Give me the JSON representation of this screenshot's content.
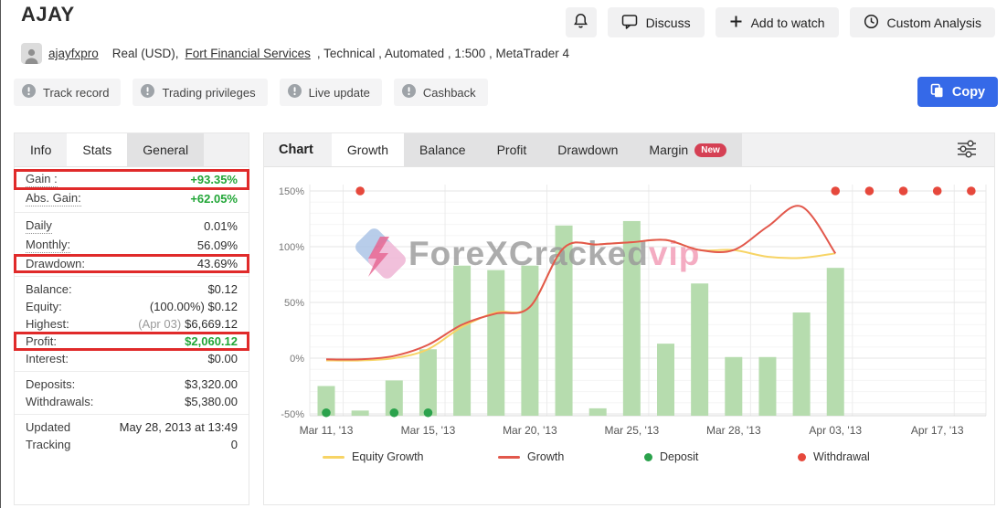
{
  "header": {
    "title": "AJAY",
    "account": {
      "username": "ajayfxpro",
      "descriptor": "Real (USD),",
      "broker": "Fort Financial Services",
      "details": ", Technical , Automated , 1:500 , MetaTrader 4"
    },
    "badges": [
      "Track record",
      "Trading privileges",
      "Live update",
      "Cashback"
    ],
    "actions": {
      "discuss": "Discuss",
      "add_to_watch": "Add to watch",
      "custom_analysis": "Custom Analysis",
      "copy": "Copy"
    }
  },
  "colors": {
    "highlight_box": "#e02a2a",
    "positive_green": "#21a637",
    "copy_button_blue": "#3569e8",
    "new_badge_red": "#d54054"
  },
  "stats_panel": {
    "tabs": [
      {
        "label": "Info",
        "selected": false,
        "variant": "plain"
      },
      {
        "label": "Stats",
        "selected": true
      },
      {
        "label": "General",
        "selected": false,
        "variant": "chip"
      }
    ],
    "rows": [
      {
        "label": "Gain :",
        "value": "+93.35%",
        "value_color": "green",
        "boxed": true,
        "dotted": true
      },
      {
        "label": "Abs. Gain:",
        "value": "+62.05%",
        "value_color": "green",
        "dotted": true
      },
      {
        "divider": true
      },
      {
        "label": "Daily",
        "value": "0.01%",
        "dotted": true
      },
      {
        "label": "Monthly:",
        "value": "56.09%",
        "dotted": true
      },
      {
        "label": "Drawdown:",
        "value": "43.69%",
        "boxed": true
      },
      {
        "divider": true
      },
      {
        "label": "Balance:",
        "value": "$0.12"
      },
      {
        "label": "Equity:",
        "value": "(100.00%) $0.12"
      },
      {
        "label": "Highest:",
        "pre": "(Apr 03)",
        "value": "$6,669.12"
      },
      {
        "label": "Profit:",
        "value": "$2,060.12",
        "value_color": "green",
        "boxed": true
      },
      {
        "label": "Interest:",
        "value": "$0.00"
      },
      {
        "divider": true
      },
      {
        "label": "Deposits:",
        "value": "$3,320.00"
      },
      {
        "label": "Withdrawals:",
        "value": "$5,380.00"
      },
      {
        "divider": true
      },
      {
        "label": "Updated",
        "value": "May 28, 2013 at 13:49"
      },
      {
        "label": "Tracking",
        "value": "0"
      }
    ]
  },
  "chart_panel": {
    "label": "Chart",
    "tabs": [
      {
        "label": "Growth",
        "selected": true
      },
      {
        "label": "Balance",
        "selected": false
      },
      {
        "label": "Profit",
        "selected": false
      },
      {
        "label": "Drawdown",
        "selected": false
      },
      {
        "label": "Margin",
        "selected": false,
        "badge": "New"
      }
    ]
  },
  "chart_data": {
    "type": "bar+line",
    "title": "Growth",
    "slot_count": 20,
    "x_labels": [
      {
        "index": 0,
        "label": "Mar 11, '13"
      },
      {
        "index": 3,
        "label": "Mar 15, '13"
      },
      {
        "index": 6,
        "label": "Mar 20, '13"
      },
      {
        "index": 9,
        "label": "Mar 25, '13"
      },
      {
        "index": 12,
        "label": "Mar 28, '13"
      },
      {
        "index": 15,
        "label": "Apr 03, '13"
      },
      {
        "index": 18,
        "label": "Apr 17, '13"
      }
    ],
    "y_ticks": [
      {
        "value": 150,
        "label": "150%"
      },
      {
        "value": 100,
        "label": "100%"
      },
      {
        "value": 50,
        "label": "50%"
      },
      {
        "value": 0,
        "label": "0%"
      },
      {
        "value": -50,
        "label": "-50%"
      }
    ],
    "ylim": [
      -52,
      155
    ],
    "y_minor_step": 10,
    "grid_x_indices": [
      0.5,
      3.5,
      6.5,
      9.5,
      12.5,
      15.5,
      18.5
    ],
    "bars": {
      "name": "balance-bars",
      "color": "#b6dcae",
      "values": [
        -25,
        -47,
        -20,
        8,
        83,
        79,
        83,
        119,
        -45,
        123,
        13,
        67,
        1,
        1,
        41,
        81,
        null,
        null,
        null,
        null
      ]
    },
    "series": [
      {
        "name": "Equity Growth",
        "color": "#f7d465",
        "values": [
          -2,
          -2,
          0,
          8,
          28,
          41,
          46,
          99,
          102,
          104,
          106,
          97,
          97,
          91,
          90,
          94
        ]
      },
      {
        "name": "Growth",
        "color": "#e2584c",
        "values": [
          -1,
          -1,
          2,
          12,
          30,
          40,
          46,
          99,
          102,
          104,
          106,
          97,
          97,
          118,
          136,
          94
        ]
      }
    ],
    "markers": [
      {
        "name": "Deposit",
        "color": "#2ba24c",
        "y": -49,
        "indices": [
          0,
          2,
          3
        ]
      },
      {
        "name": "Withdrawal",
        "color": "#e6483c",
        "y": 150,
        "indices": [
          1,
          15,
          16,
          17,
          18,
          19
        ]
      }
    ],
    "legend": [
      {
        "label": "Equity Growth",
        "type": "line",
        "color": "#f7d465"
      },
      {
        "label": "Growth",
        "type": "line",
        "color": "#e2584c"
      },
      {
        "label": "Deposit",
        "type": "dot",
        "color": "#2ba24c"
      },
      {
        "label": "Withdrawal",
        "type": "dot",
        "color": "#e6483c"
      }
    ],
    "watermark": {
      "text": "ForeXCracked",
      "accent": "vip"
    }
  }
}
